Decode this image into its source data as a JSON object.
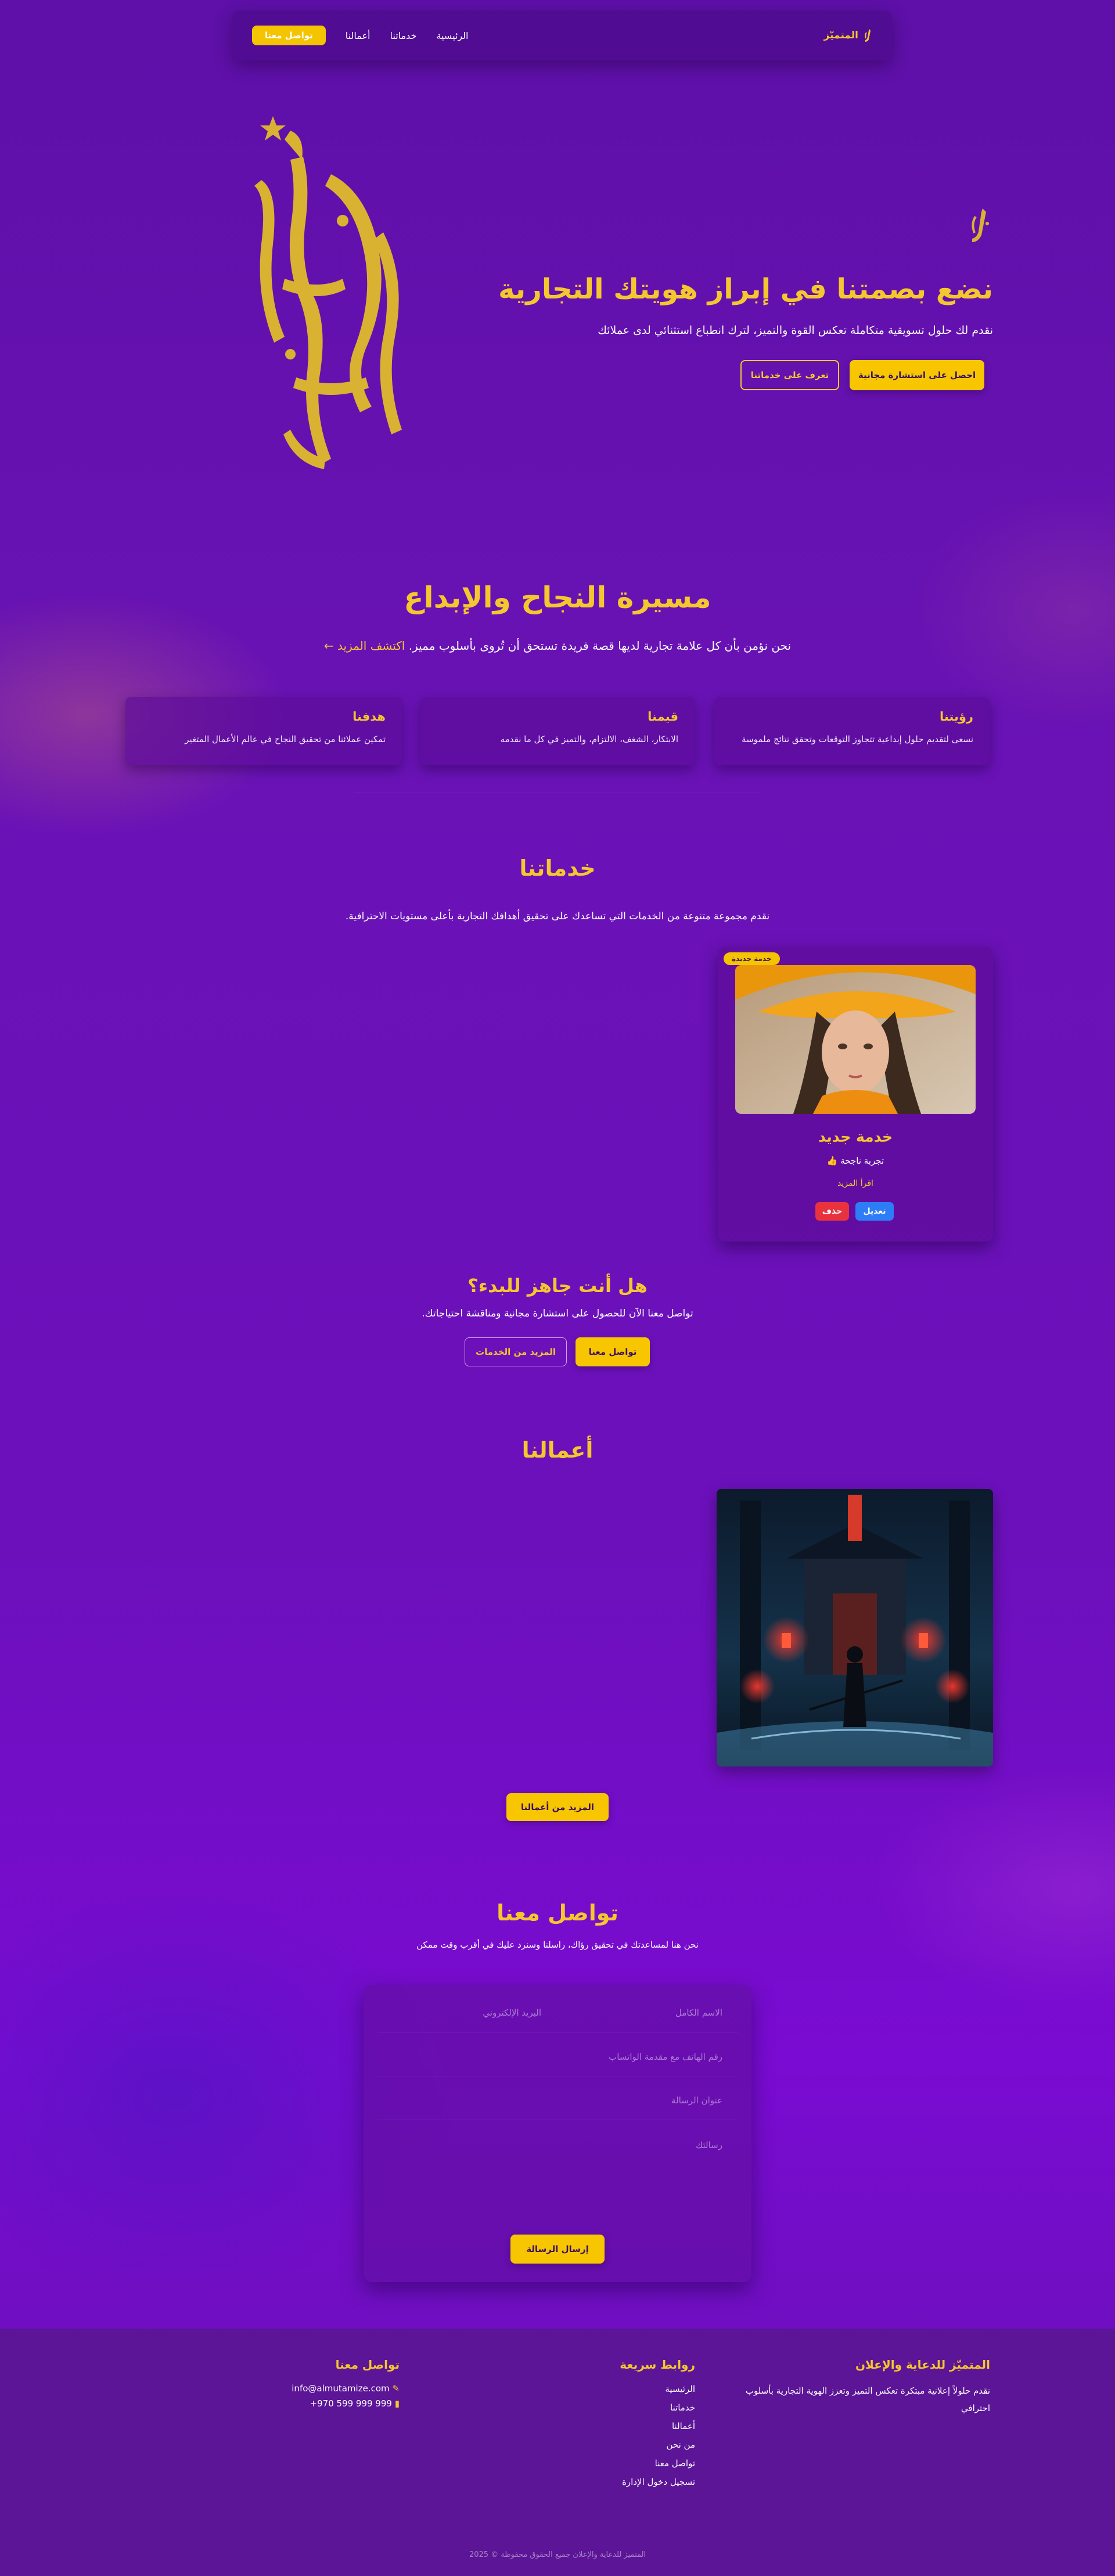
{
  "nav": {
    "brand": "المتميّز",
    "links": [
      "الرئيسية",
      "خدماتنا",
      "أعمالنا"
    ],
    "cta": "تواصل معنا"
  },
  "hero": {
    "title": "نضع بصمتنا في إبراز هويتك التجارية",
    "subtitle": "نقدم لك حلول تسويقية متكاملة تعكس القوة والتميز، لترك انطباع استثنائي لدى عملائك",
    "primary_button": "احصل على استشارة مجانية",
    "secondary_button": "تعرف على خدماتنا"
  },
  "journey": {
    "title": "مسيرة النجاح والإبداع",
    "subtitle": "نحن نؤمن بأن كل علامة تجارية لديها قصة فريدة تستحق أن تُروى بأسلوب مميز.",
    "discover": "اكتشف المزيد",
    "cards": [
      {
        "title": "رؤيتنا",
        "text": "نسعى لتقديم حلول إبداعية تتجاوز التوقعات وتحقق نتائج ملموسة"
      },
      {
        "title": "قيمنا",
        "text": "الابتكار، الشغف، الالتزام، والتميز في كل ما نقدمه"
      },
      {
        "title": "هدفنا",
        "text": "تمكين عملائنا من تحقيق النجاح في عالم الأعمال المتغير"
      }
    ]
  },
  "services": {
    "title": "خدماتنا",
    "subtitle": "نقدم مجموعة متنوعة من الخدمات التي تساعدك على تحقيق أهدافك التجارية بأعلى مستويات الاحترافية.",
    "card": {
      "badge": "خدمة جديدة",
      "title": "خدمة جديد",
      "line": "تجربة ناجحة",
      "read_more": "اقرأ المزيد",
      "edit": "تعديل",
      "delete": "حذف"
    }
  },
  "cta": {
    "title": "هل أنت جاهز للبدء؟",
    "subtitle": "تواصل معنا الآن للحصول على استشارة مجانية ومناقشة احتياجاتك.",
    "primary": "تواصل معنا",
    "secondary": "المزيد من الخدمات"
  },
  "works": {
    "title": "أعمالنا",
    "more": "المزيد من أعمالنا"
  },
  "contact": {
    "title": "تواصل معنا",
    "subtitle": "نحن هنا لمساعدتك في تحقيق رؤاك، راسلنا وسنرد عليك في أقرب وقت ممكن",
    "name_placeholder": "الاسم الكامل",
    "email_placeholder": "البريد الإلكتروني",
    "phone_placeholder": "رقم الهاتف مع مقدمة الواتساب",
    "subject_placeholder": "عنوان الرسالة",
    "message_placeholder": "رسالتك",
    "submit": "إرسال الرسالة"
  },
  "footer": {
    "about_title": "المتميّز للدعاية والإعلان",
    "about_text": "نقدم حلولاً إعلانية مبتكرة تعكس التميز وتعزز الهوية التجارية بأسلوب احترافي",
    "links_title": "روابط سريعة",
    "links": [
      "الرئيسية",
      "خدماتنا",
      "أعمالنا",
      "من نحن",
      "تواصل معنا",
      "تسجيل دخول الإدارة"
    ],
    "contact_title": "تواصل معنا",
    "email": "info@almutamize.com",
    "phone": "+970 599 999 999",
    "copyright": "المتميز للدعاية والإعلان جميع الحقوق محفوظة © 2025"
  },
  "colors": {
    "accent": "#f5c72e",
    "button": "#f7c600",
    "edit": "#2d7df6",
    "delete": "#e8323e"
  }
}
